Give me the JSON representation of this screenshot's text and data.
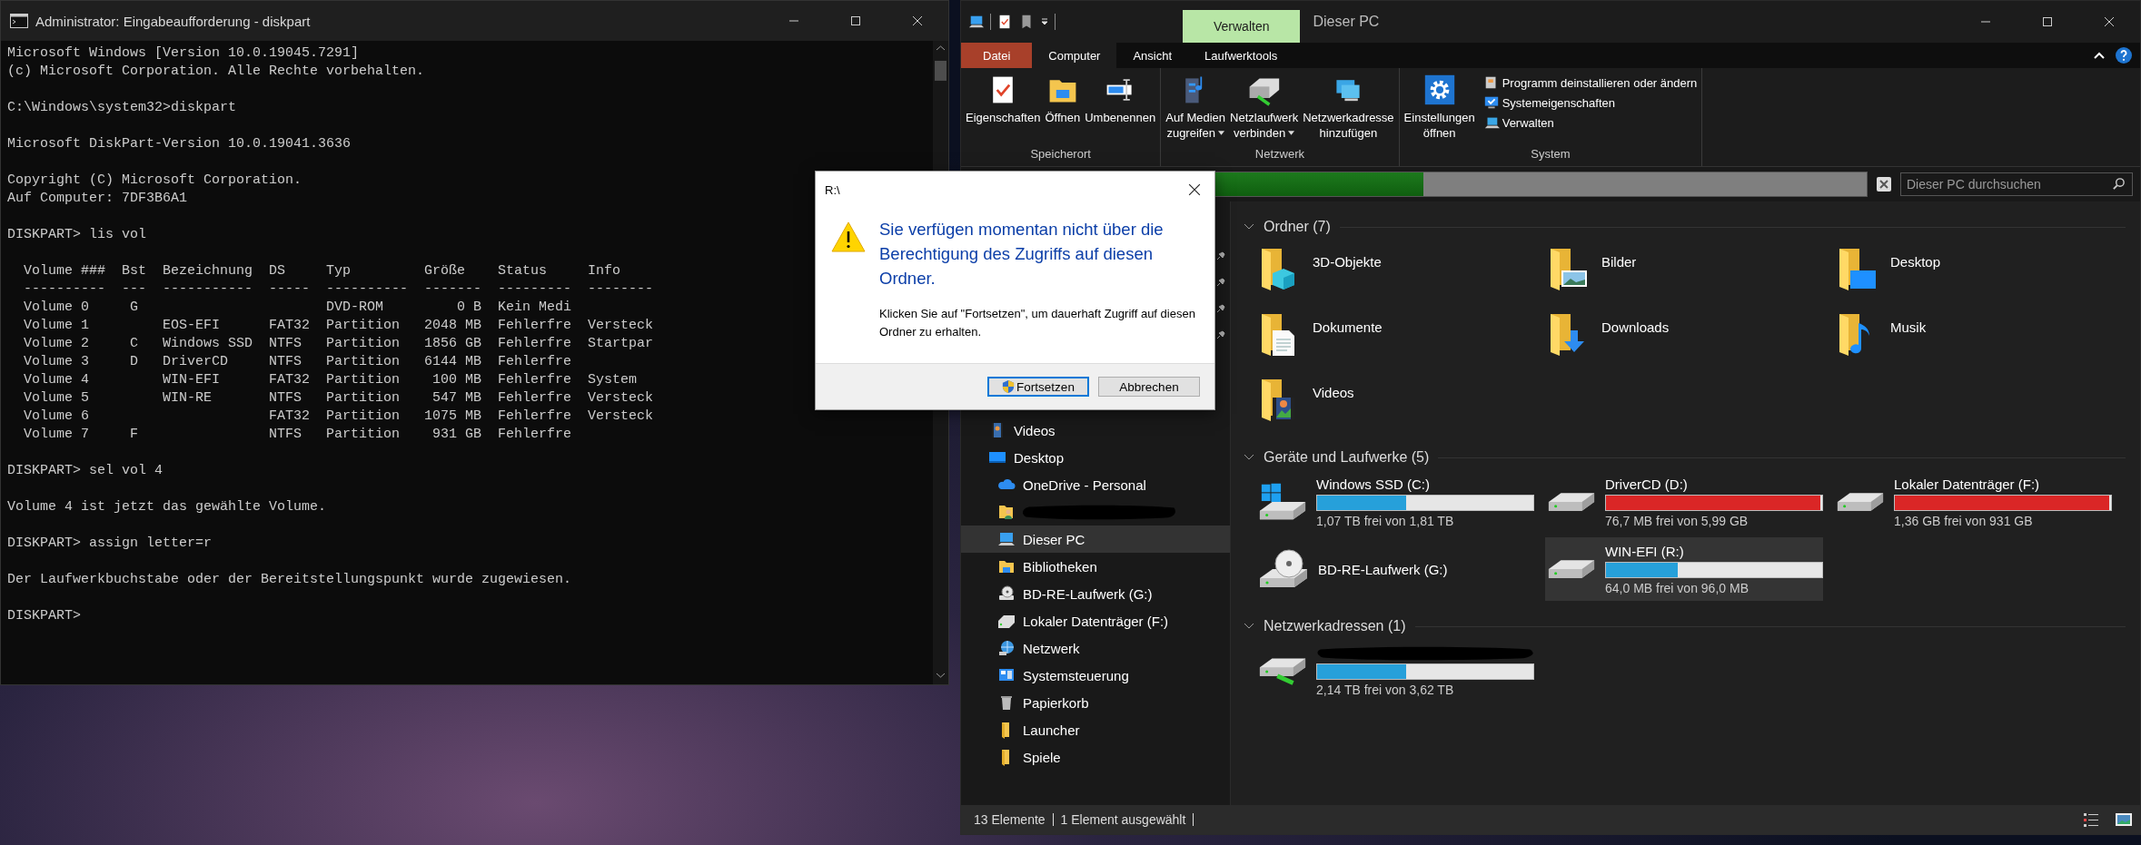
{
  "terminal": {
    "title": "Administrator: Eingabeaufforderung - diskpart",
    "blocks": [
      [
        "Microsoft Windows [Version 10.0.19045.7291]",
        "(c) Microsoft Corporation. Alle Rechte vorbehalten."
      ],
      [
        "C:\\Windows\\system32>diskpart"
      ],
      [
        "Microsoft DiskPart-Version 10.0.19041.3636"
      ],
      [
        "Copyright (C) Microsoft Corporation.",
        "Auf Computer: 7DF3B6A1"
      ],
      [
        "DISKPART> lis vol"
      ],
      [
        "  Volume ###  Bst  Bezeichnung  DS     Typ         Größe    Status     Info",
        "  ----------  ---  -----------  -----  ----------  -------  ---------  --------",
        "  Volume 0     G                       DVD-ROM         0 B  Kein Medi",
        "  Volume 1         EOS-EFI      FAT32  Partition   2048 MB  Fehlerfre  Versteck",
        "  Volume 2     C   Windows SSD  NTFS   Partition   1856 GB  Fehlerfre  Startpar",
        "  Volume 3     D   DriverCD     NTFS   Partition   6144 MB  Fehlerfre",
        "  Volume 4         WIN-EFI      FAT32  Partition    100 MB  Fehlerfre  System",
        "  Volume 5         WIN-RE       NTFS   Partition    547 MB  Fehlerfre  Versteck",
        "  Volume 6                      FAT32  Partition   1075 MB  Fehlerfre  Versteck",
        "  Volume 7     F                NTFS   Partition    931 GB  Fehlerfre"
      ],
      [
        "DISKPART> sel vol 4"
      ],
      [
        "Volume 4 ist jetzt das gewählte Volume."
      ],
      [
        "DISKPART> assign letter=r"
      ],
      [
        "Der Laufwerkbuchstabe oder der Bereitstellungspunkt wurde zugewiesen."
      ],
      [
        "DISKPART>"
      ]
    ]
  },
  "explorer": {
    "context_tab": "Verwalten",
    "title": "Dieser PC",
    "ribbon": {
      "tabs": [
        {
          "label": "Datei",
          "kind": "file",
          "selected": false
        },
        {
          "label": "Computer",
          "kind": "tab",
          "selected": true
        },
        {
          "label": "Ansicht",
          "kind": "tab",
          "selected": false
        },
        {
          "label": "Laufwerktools",
          "kind": "tab",
          "selected": false
        }
      ],
      "groups": [
        {
          "label": "Speicherort",
          "buttons": [
            {
              "kind": "properties",
              "lines": [
                "Eigenschaften"
              ],
              "dropdown": false
            },
            {
              "kind": "open",
              "lines": [
                "Öffnen"
              ],
              "dropdown": false
            },
            {
              "kind": "rename",
              "lines": [
                "Umbenennen"
              ],
              "dropdown": false
            }
          ]
        },
        {
          "label": "Netzwerk",
          "buttons": [
            {
              "kind": "media",
              "lines": [
                "Auf Medien",
                "zugreifen"
              ],
              "dropdown": true
            },
            {
              "kind": "map-drive",
              "lines": [
                "Netzlaufwerk",
                "verbinden"
              ],
              "dropdown": true
            },
            {
              "kind": "add-location",
              "lines": [
                "Netzwerkadresse",
                "hinzufügen"
              ],
              "dropdown": false
            }
          ]
        },
        {
          "label": "System",
          "buttons": [
            {
              "kind": "settings",
              "lines": [
                "Einstellungen",
                "öffnen"
              ],
              "dropdown": false
            }
          ],
          "small": [
            {
              "kind": "uninstall",
              "label": "Programm deinstallieren oder ändern"
            },
            {
              "kind": "sysprops",
              "label": "Systemeigenschaften"
            },
            {
              "kind": "manage",
              "label": "Verwalten"
            }
          ]
        }
      ]
    },
    "address_bar": {
      "level": 0.46
    },
    "search": {
      "placeholder": "Dieser PC durchsuchen"
    },
    "nav": [
      {
        "label": "Videos",
        "kind": "video",
        "selected": false,
        "redacted": false
      },
      {
        "label": "Desktop",
        "kind": "desktop",
        "selected": false,
        "redacted": false,
        "children": [
          {
            "label": "OneDrive - Personal",
            "kind": "cloud",
            "selected": false,
            "redacted": false
          },
          {
            "kind": "user",
            "selected": false,
            "redacted": true
          },
          {
            "label": "Dieser PC",
            "kind": "pc",
            "selected": true,
            "redacted": false
          },
          {
            "label": "Bibliotheken",
            "kind": "library",
            "selected": false,
            "redacted": false
          },
          {
            "label": "BD-RE-Laufwerk (G:)",
            "kind": "optical",
            "selected": false,
            "redacted": false
          },
          {
            "label": "Lokaler Datenträger (F:)",
            "kind": "drive",
            "selected": false,
            "redacted": false
          },
          {
            "label": "Netzwerk",
            "kind": "network",
            "selected": false,
            "redacted": false
          },
          {
            "label": "Systemsteuerung",
            "kind": "control",
            "selected": false,
            "redacted": false
          },
          {
            "label": "Papierkorb",
            "kind": "recycle",
            "selected": false,
            "redacted": false
          },
          {
            "label": "Launcher",
            "kind": "folder",
            "selected": false,
            "redacted": false
          },
          {
            "label": "Spiele",
            "kind": "folder",
            "selected": false,
            "redacted": false
          }
        ]
      }
    ],
    "sections": [
      {
        "title": "Ordner (7)",
        "kind": "folders",
        "items": [
          {
            "label": "3D-Objekte",
            "kind": "objects"
          },
          {
            "label": "Bilder",
            "kind": "pictures"
          },
          {
            "label": "Desktop",
            "kind": "desktop"
          },
          {
            "label": "Dokumente",
            "kind": "documents"
          },
          {
            "label": "Downloads",
            "kind": "downloads"
          },
          {
            "label": "Musik",
            "kind": "music"
          },
          {
            "label": "Videos",
            "kind": "videos"
          }
        ]
      },
      {
        "title": "Geräte und Laufwerke (5)",
        "kind": "drives",
        "items": [
          {
            "label": "Windows SSD (C:)",
            "kind": "windows",
            "level": 0.41,
            "warning": false,
            "free": "1,07 TB frei von 1,81 TB",
            "selected": false,
            "redacted": false
          },
          {
            "label": "DriverCD (D:)",
            "kind": "hdd",
            "level": 0.99,
            "warning": true,
            "free": "76,7 MB frei von 5,99 GB",
            "selected": false,
            "redacted": false
          },
          {
            "label": "Lokaler Datenträger (F:)",
            "kind": "hdd",
            "level": 0.99,
            "warning": true,
            "free": "1,36 GB frei von 931 GB",
            "selected": false,
            "redacted": false
          },
          {
            "label": "BD-RE-Laufwerk (G:)",
            "kind": "optical",
            "selected": false,
            "redacted": false
          },
          {
            "label": "WIN-EFI (R:)",
            "kind": "hdd",
            "level": 0.33,
            "warning": false,
            "free": "64,0 MB frei von 96,0 MB",
            "selected": true,
            "redacted": false
          }
        ]
      },
      {
        "title": "Netzwerkadressen (1)",
        "kind": "drives",
        "items": [
          {
            "kind": "network",
            "level": 0.41,
            "warning": false,
            "free": "2,14 TB frei von 3,62 TB",
            "selected": false,
            "redacted": true
          }
        ]
      }
    ],
    "status": [
      "13 Elemente",
      "1 Element ausgewählt"
    ]
  },
  "dialog": {
    "title": "R:\\",
    "heading": "Sie verfügen momentan nicht über die Berechtigung des Zugriffs auf diesen Ordner.",
    "body": "Klicken Sie auf \"Fortsetzen\", um dauerhaft Zugriff auf diesen Ordner zu erhalten.",
    "buttons": [
      {
        "label": "Fortsetzen",
        "kind": "shield",
        "default": true
      },
      {
        "label": "Abbrechen",
        "kind": "plain",
        "default": false
      }
    ]
  }
}
